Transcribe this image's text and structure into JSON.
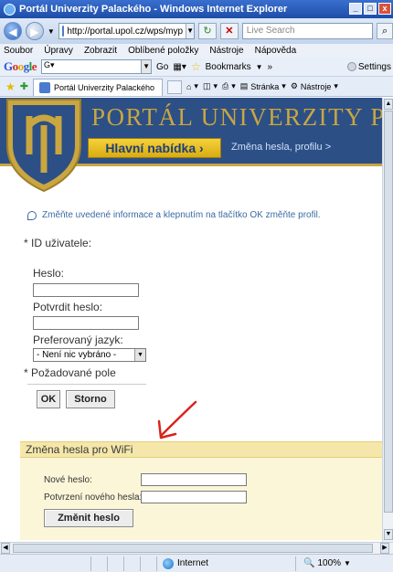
{
  "window": {
    "title": "Portál Univerzity Palackého - Windows Internet Explorer",
    "buttons": [
      "_",
      "□",
      "x"
    ]
  },
  "nav": {
    "address": "http://portal.upol.cz/wps/myp",
    "search_placeholder": "Live Search"
  },
  "menu": {
    "items": [
      "Soubor",
      "Úpravy",
      "Zobrazit",
      "Oblíbené položky",
      "Nástroje",
      "Nápověda"
    ]
  },
  "google": {
    "go_label": "Go",
    "bookmarks_label": "Bookmarks",
    "more_label": "»",
    "settings_label": "Settings"
  },
  "tabs": {
    "active_label": "Portál Univerzity Palackého",
    "page_label": "Stránka",
    "tools_label": "Nástroje"
  },
  "banner": {
    "title": "PORTÁL UNIVERZITY PALA",
    "menu_button": "Hlavní nabídka ›",
    "breadcrumb": "Změna hesla, profilu >"
  },
  "form": {
    "notice": "Změňte uvedené informace a klepnutím na tlačítko OK změňte profil.",
    "user_id_label": "* ID uživatele:",
    "password_label": "Heslo:",
    "confirm_label": "Potvrdit heslo:",
    "language_label": "Preferovaný jazyk:",
    "language_value": "- Není nic vybráno -",
    "required_note": "* Požadované pole",
    "ok_label": "OK",
    "cancel_label": "Storno"
  },
  "wifi": {
    "heading": "Změna hesla pro WiFi",
    "new_password_label": "Nové heslo:",
    "confirm_new_label": "Potvrzení nového hesla:",
    "change_button": "Změnit heslo"
  },
  "status": {
    "zone": "Internet",
    "zoom": "100%"
  },
  "colors": {
    "banner_blue": "#2c4f86",
    "gold": "#c9a640",
    "menu_button": "#e8c02a",
    "wifi_header": "#f4e7a9",
    "arrow_red": "#d9241a"
  }
}
